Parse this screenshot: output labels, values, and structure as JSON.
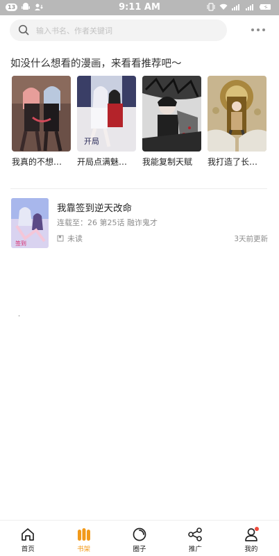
{
  "status_bar": {
    "notification_count": "13",
    "time": "9:11 AM"
  },
  "search": {
    "placeholder": "输入书名、作者关键词"
  },
  "recommend": {
    "title": "如没什么想看的漫画，来看看推荐吧～",
    "items": [
      {
        "name": "我真的不想…"
      },
      {
        "name": "开局点满魅…"
      },
      {
        "name": "我能复制天赋"
      },
      {
        "name": "我打造了长…"
      }
    ]
  },
  "shelf": {
    "items": [
      {
        "title": "我靠签到逆天改命",
        "progress": "连载至：26 第25话 融诈鬼才",
        "status": "未读",
        "updated": "3天前更新"
      }
    ]
  },
  "tab_bar": {
    "tabs": [
      {
        "label": "首页",
        "icon": "home-icon"
      },
      {
        "label": "书架",
        "icon": "bookshelf-icon"
      },
      {
        "label": "圈子",
        "icon": "circle-icon"
      },
      {
        "label": "推广",
        "icon": "share-icon"
      },
      {
        "label": "我的",
        "icon": "user-icon"
      }
    ]
  },
  "colors": {
    "accent": "#f29a1a",
    "notification_dot": "#f04b3c",
    "status_bar": "#b8b8b8"
  }
}
